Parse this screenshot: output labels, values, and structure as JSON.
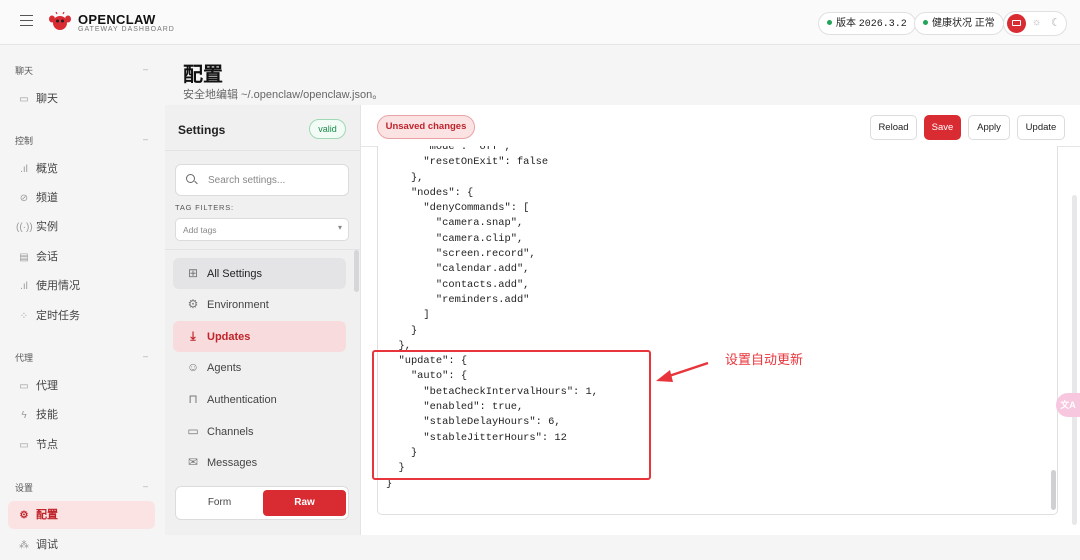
{
  "header": {
    "brand": "OPENCLAW",
    "brand_sub": "GATEWAY DASHBOARD",
    "version_label": "版本",
    "version_value": "2026.3.2",
    "health_label": "健康状况",
    "health_value": "正常"
  },
  "sidebar": {
    "sections": [
      {
        "label": "聊天",
        "collapse": "–"
      },
      {
        "label": "控制",
        "collapse": "–"
      },
      {
        "label": "代理",
        "collapse": "–"
      },
      {
        "label": "设置",
        "collapse": "–"
      }
    ],
    "items": [
      {
        "label": "聊天",
        "icon": "chat-icon"
      },
      {
        "label": "概览",
        "icon": "bar-chart-icon"
      },
      {
        "label": "频道",
        "icon": "link-icon"
      },
      {
        "label": "实例",
        "icon": "radio-icon"
      },
      {
        "label": "会话",
        "icon": "document-icon"
      },
      {
        "label": "使用情况",
        "icon": "bar-chart-icon"
      },
      {
        "label": "定时任务",
        "icon": "loader-icon"
      },
      {
        "label": "代理",
        "icon": "folder-icon"
      },
      {
        "label": "技能",
        "icon": "bolt-icon"
      },
      {
        "label": "节点",
        "icon": "monitor-icon"
      },
      {
        "label": "配置",
        "icon": "gear-icon"
      },
      {
        "label": "调试",
        "icon": "bug-icon"
      }
    ],
    "active": "配置"
  },
  "page": {
    "title": "配置",
    "subtitle": "安全地编辑 ~/.openclaw/openclaw.json。"
  },
  "settings_pane": {
    "title": "Settings",
    "status": "valid",
    "search_placeholder": "Search settings...",
    "tag_filters_label": "TAG FILTERS:",
    "tags_placeholder": "Add tags",
    "items": [
      {
        "label": "All Settings",
        "icon": "grid-icon"
      },
      {
        "label": "Environment",
        "icon": "gear-icon"
      },
      {
        "label": "Updates",
        "icon": "download-icon"
      },
      {
        "label": "Agents",
        "icon": "robot-icon"
      },
      {
        "label": "Authentication",
        "icon": "lock-icon"
      },
      {
        "label": "Channels",
        "icon": "chat-icon"
      },
      {
        "label": "Messages",
        "icon": "mail-icon"
      }
    ],
    "mode_form": "Form",
    "mode_raw": "Raw"
  },
  "toolbar": {
    "unsaved": "Unsaved changes",
    "reload": "Reload",
    "save": "Save",
    "apply": "Apply",
    "update": "Update"
  },
  "editor": {
    "lines": [
      "      \"mode\": \"off\",",
      "      \"resetOnExit\": false",
      "    },",
      "    \"nodes\": {",
      "      \"denyCommands\": [",
      "        \"camera.snap\",",
      "        \"camera.clip\",",
      "        \"screen.record\",",
      "        \"calendar.add\",",
      "        \"contacts.add\",",
      "        \"reminders.add\"",
      "      ]",
      "    }",
      "  },",
      "  \"update\": {",
      "    \"auto\": {",
      "      \"betaCheckIntervalHours\": 1,",
      "      \"enabled\": true,",
      "      \"stableDelayHours\": 6,",
      "      \"stableJitterHours\": 12",
      "    }",
      "  }",
      "}"
    ]
  },
  "annotation": {
    "text": "设置自动更新",
    "color": "#e8343b"
  },
  "colors": {
    "accent": "#d92b32",
    "accent_soft": "#fbe3e4",
    "valid_green": "#1a8a4a"
  }
}
